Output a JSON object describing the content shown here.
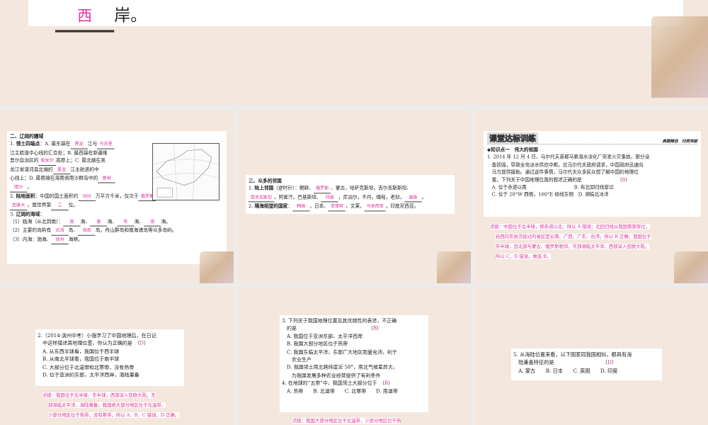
{
  "slides": [
    {
      "id": "top",
      "lines": [
        [
          {
            "b": "西"
          },
          "岸。"
        ]
      ]
    },
    {
      "id": "s1",
      "lines": [
        [
          {
            "h": "二、辽阔的疆域"
          }
        ],
        [
          "1. ",
          {
            "h": "领土四端点"
          },
          "：A. 最东端在",
          {
            "b": "黑龙"
          },
          "江与",
          {
            "b": "乌苏里"
          }
        ],
        [
          "江主航道中心线的汇合处；B. 最西端在新疆维"
        ],
        [
          "吾尔自治区的",
          {
            "b": "帕米尔"
          },
          "高原上；C. 最北端在黑"
        ],
        [
          "龙江省漠河县北端的",
          {
            "b": "黑龙"
          },
          "江主航道的中"
        ],
        [
          "心线上；D. 最南端在海南省南沙群岛中的",
          {
            "b": "曾母"
          }
        ],
        [
          {
            "b": "暗沙"
          },
          "。"
        ],
        [
          "2. ",
          {
            "h": "陆地面积"
          },
          "：中国的国土面积约",
          {
            "b": "960"
          },
          "万平方千米，仅次于",
          {
            "b": "俄罗斯"
          },
          "和"
        ],
        [
          {
            "b": "加拿大"
          },
          "，居世界第",
          {
            "b": "三"
          },
          "位。"
        ],
        [
          "3. ",
          {
            "h": "辽阔的海域"
          },
          "："
        ],
        [
          "（1）临海（从北到南）：",
          {
            "b": "渤"
          },
          "海、",
          {
            "b": "黄"
          },
          "海、",
          {
            "b": "东"
          },
          "海、",
          {
            "b": "南"
          },
          "海。"
        ],
        [
          "（2）主要的岛屿有",
          {
            "b": "台湾"
          },
          "岛、",
          {
            "b": "海南"
          },
          "岛，舟山群岛和南海诸岛等众多岛屿。"
        ],
        [
          "（3）内海：渤海、",
          {
            "b": "琼州"
          },
          "海峡。"
        ]
      ]
    },
    {
      "id": "s2",
      "lines": [
        [
          {
            "h": "三、众多的邻国"
          }
        ],
        [
          "1. ",
          {
            "h": "陆上邻国"
          },
          "（逆时针）：朝鲜、",
          {
            "b": "俄罗斯"
          },
          "、蒙古，哈萨克斯坦，吉尔吉斯斯坦、"
        ],
        [
          {
            "b": "塔吉克斯坦"
          },
          "，阿富汗，巴基斯坦、",
          {
            "b": "印度"
          },
          "，尼泊尔，不丹，缅甸，老挝，",
          {
            "b": "越南"
          },
          "。"
        ],
        [
          "2. ",
          {
            "h": "隔海相望的国家"
          },
          "：",
          {
            "b": "韩国"
          },
          "，日本、",
          {
            "b": "菲律宾"
          },
          "，文莱，",
          {
            "b": "马来西亚"
          },
          "，印度尼西亚。"
        ]
      ]
    },
    {
      "id": "s3",
      "lines": [
        [
          {
            "h": "◆知识点一　伟大的祖国"
          }
        ],
        [
          "1. 2014 年 12 月 4 日，马尔代夫首都马累海水淡化厂突发火灾事故，部分设"
        ],
        [
          "　备损毁，导致全岛淡水供应中断。应马尔代夫政府请求，中国政府迅速向"
        ],
        [
          "　马方提供援助。通过这件事情，马尔代夫众多民众想了解中国的地理位"
        ],
        [
          "　置。下列关于中国地理位置的叙述正确的是　　　　　　　　（",
          {
            "a": "B"
          },
          "）"
        ],
        [
          "　A. 位于赤道以南　　　　　　　　　　B. 有北回归线穿过"
        ],
        [
          "　C. 位于 20°W 西侧，160°E 经线东侧　D. 濒临北冰洋"
        ]
      ],
      "banner": {
        "title": "课堂达标训练",
        "subtitle": "典题精选　归类突破"
      },
      "note": [
        "点拨：中国位于北半球，即赤道以北，所以 A 错误；北回归线从我国南部穿过，",
        "自西向东依次经过的省区是云南、广西、广东、台湾，所以 B 正确；我国位于",
        "东半球，且北部与蒙古、俄罗斯相邻，东部濒临太平洋，西部深入亚欧大陆，",
        "所以 C、D 错误。故选 B。"
      ]
    },
    {
      "id": "s4",
      "lines": [
        [
          "2.（2014·滨州中考）小强学习了中国地理后，在日记"
        ],
        [
          "　中这样描述其地理位置，你认为正确的是　（",
          {
            "a": "D"
          },
          "）"
        ],
        [
          "　A. 从东西半球看，我国位于西半球"
        ],
        [
          "　B. 从南北半球看，我国位于南半球"
        ],
        [
          "　C. 大部分位于北温带和北寒带，没有热带"
        ],
        [
          "　D. 位于亚洲的东部，太平洋西岸，海陆兼备"
        ]
      ],
      "note": [
        "点拨：我国位于北半球、东半球，西部深入亚欧大陆，东",
        "部濒临太平洋，海陆兼备；我国绝大部分地区位于北温带，",
        "少部分地区位于热带，没有寒带，所以 A、B、C 错误，D 正确。"
      ]
    },
    {
      "id": "s5",
      "lines": [
        [
          "3. 下列关于我国地理位置及其优越性的表述，不正确"
        ],
        [
          "　的是　　　　　　　　　　　　　　　（",
          {
            "a": "B"
          },
          "）"
        ],
        [
          "　A. 我国位于亚洲东部、太平洋西岸"
        ],
        [
          "　B. 我国大部分地区位于热带"
        ],
        [
          "　C. 我国东临太平洋，东部广大地区雨量充沛，利于"
        ],
        [
          "　　农业生产"
        ],
        [
          "　D. 我国领土南北跨纬度近 50°，南北气候差异大，"
        ],
        [
          "　　为我国发展多种农业经营提供了有利条件"
        ],
        [
          "4. 在地球的“五带”中，我国领土大部分位于　（",
          {
            "a": "B"
          },
          "）"
        ],
        [
          "　A. 热带　　B. 北温带　　C. 北寒带　　D. 南温带"
        ]
      ],
      "note": [
        "点拨：我国大部分地区位于北温带，少部分地区位于热"
      ]
    },
    {
      "id": "s6",
      "lines": [
        [
          "5. 从海陆位置来看，以下国家同我国相似，都具有海"
        ],
        [
          "　陆兼备特征的是　　　　　　　　　　（",
          {
            "a": "D"
          },
          "）"
        ],
        [
          "　A. 蒙古　　B. 日本　　C. 英国　　D. 印度"
        ]
      ]
    }
  ]
}
